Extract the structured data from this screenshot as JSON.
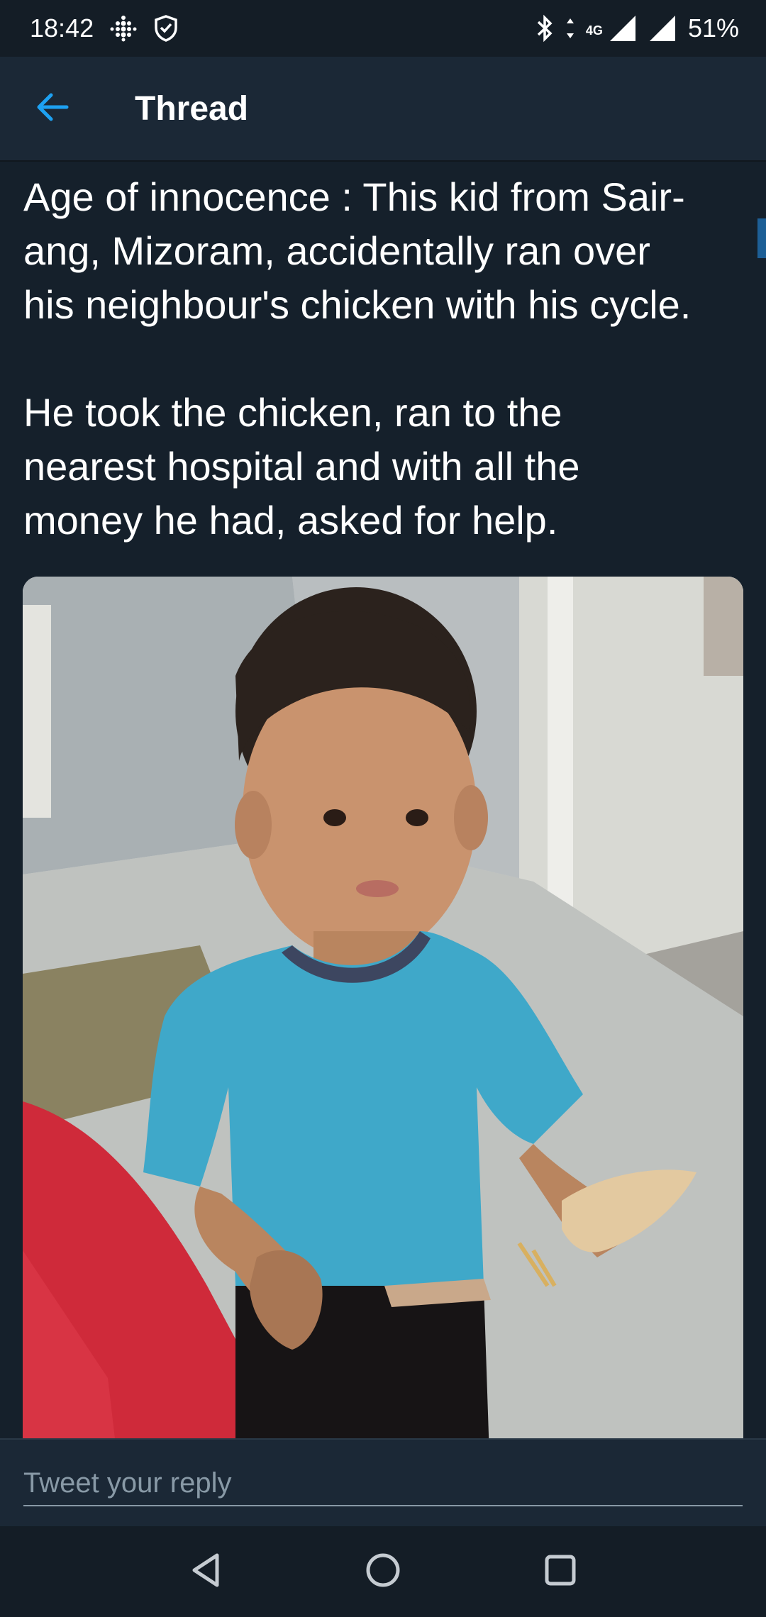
{
  "status_bar": {
    "time": "18:42",
    "network": "4G",
    "battery": "51%",
    "icons": [
      "grid-dots-icon",
      "shield-icon",
      "bluetooth-icon",
      "data-arrows-icon",
      "signal-icon",
      "signal-icon-2"
    ]
  },
  "header": {
    "title": "Thread",
    "back_icon": "arrow-left-icon",
    "accent_color": "#1da1f2"
  },
  "tweet": {
    "text": "Age of innocence : This kid from Sair-\nang, Mizoram, accidentally ran over\nhis neighbour's chicken with his cycle.\n\nHe took the chicken, ran to the\nnearest hospital and with all the\nmoney he had, asked for help."
  },
  "reply": {
    "placeholder": "Tweet your reply",
    "value": ""
  },
  "nav": {
    "icons": [
      "back-triangle-icon",
      "home-circle-icon",
      "recents-square-icon"
    ]
  },
  "colors": {
    "background": "#15202b",
    "bar": "#1b2836",
    "secondary_text": "#8899a6"
  }
}
